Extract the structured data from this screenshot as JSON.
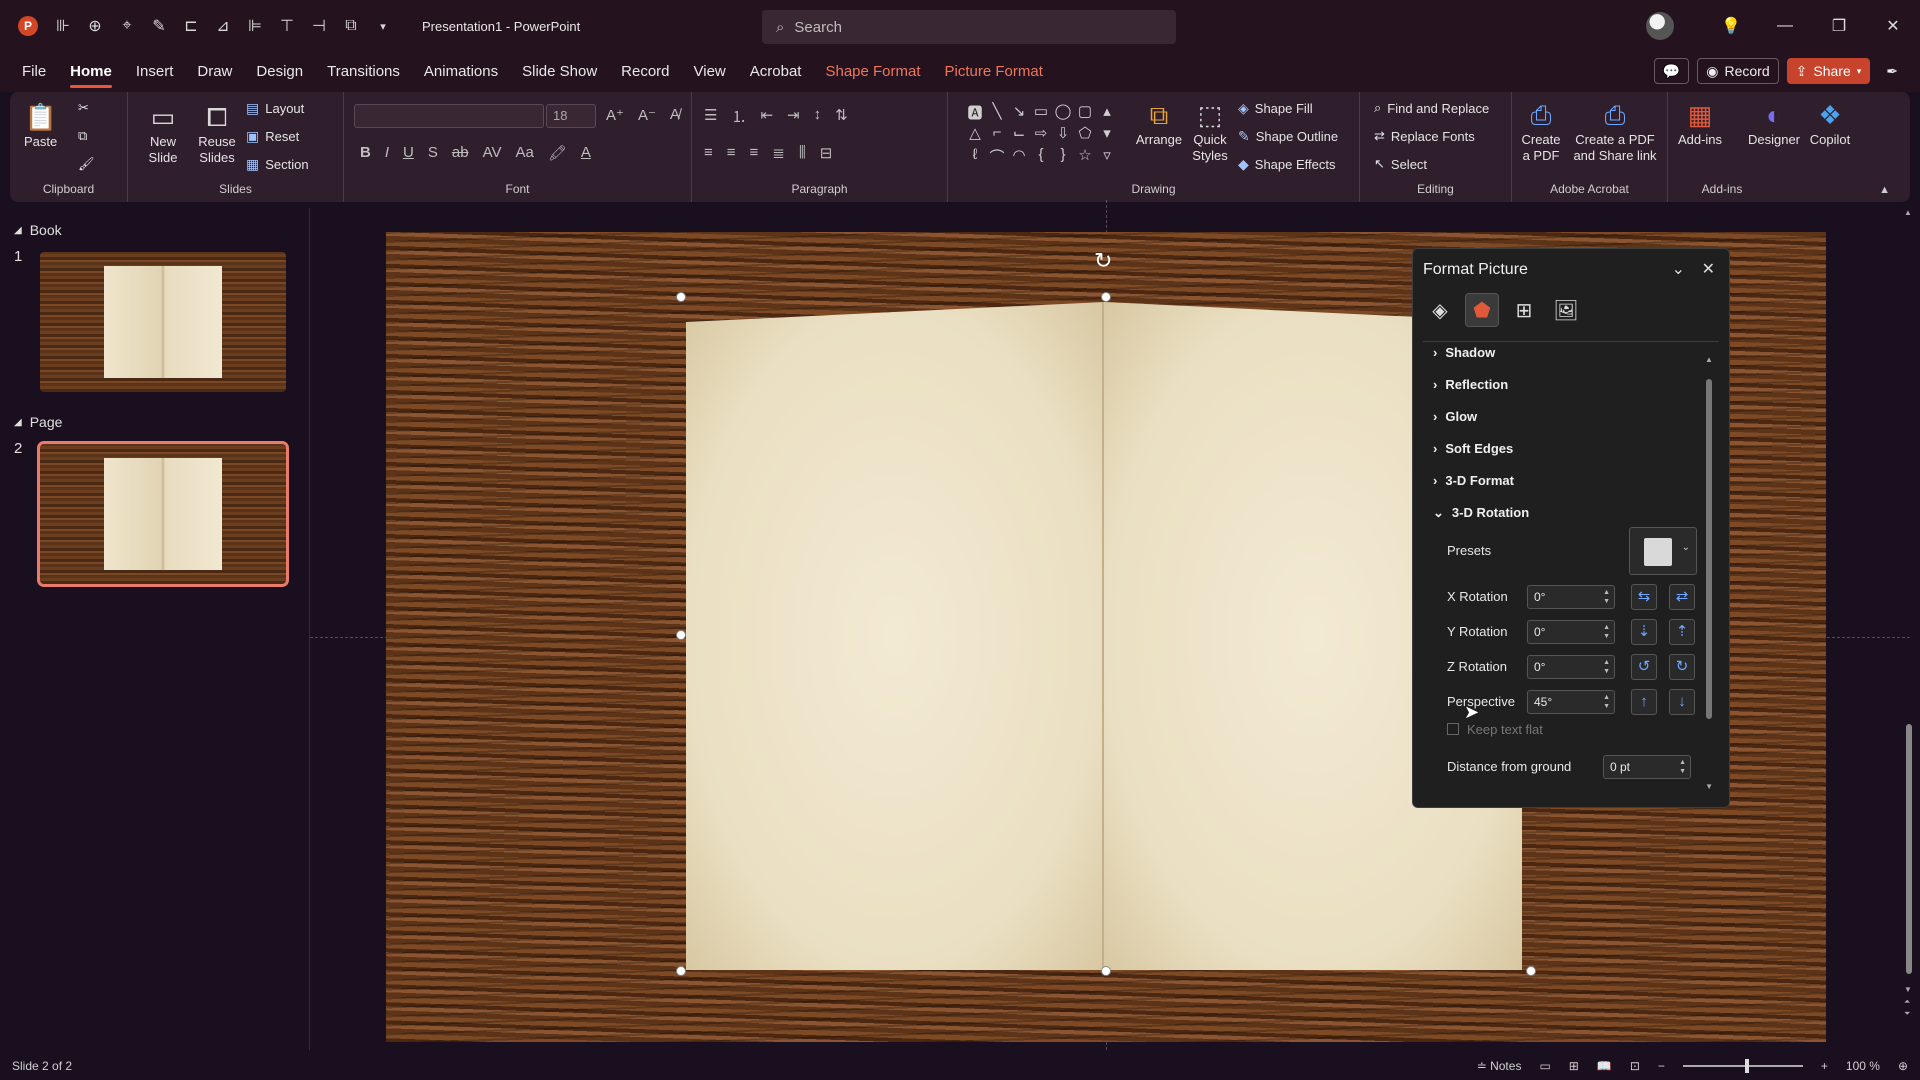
{
  "titlebar": {
    "app_icon": "P",
    "qat_icons": [
      "qat-1-icon",
      "qat-2-icon",
      "qat-3-icon",
      "qat-4-icon",
      "qat-5-icon",
      "qat-6-icon",
      "qat-7-icon",
      "qat-8-icon",
      "qat-9-icon",
      "qat-10-icon"
    ],
    "doc_title": "Presentation1  -  PowerPoint",
    "search_placeholder": "Search"
  },
  "menu": {
    "tabs": [
      "File",
      "Home",
      "Insert",
      "Draw",
      "Design",
      "Transitions",
      "Animations",
      "Slide Show",
      "Record",
      "View",
      "Acrobat",
      "Shape Format",
      "Picture Format"
    ],
    "active_tab": "Home",
    "record_label": "Record",
    "share_label": "Share"
  },
  "ribbon": {
    "clipboard": {
      "paste": "Paste",
      "label": "Clipboard"
    },
    "slides": {
      "new_slide": "New Slide",
      "reuse_slides": "Reuse Slides",
      "layout": "Layout",
      "reset": "Reset",
      "section": "Section",
      "label": "Slides"
    },
    "font": {
      "size": "18",
      "label": "Font"
    },
    "paragraph": {
      "label": "Paragraph"
    },
    "drawing": {
      "arrange": "Arrange",
      "quick_styles": "Quick Styles",
      "shape_fill": "Shape Fill",
      "shape_outline": "Shape Outline",
      "shape_effects": "Shape Effects",
      "label": "Drawing"
    },
    "editing": {
      "find_replace": "Find and Replace",
      "replace_fonts": "Replace Fonts",
      "select": "Select",
      "label": "Editing"
    },
    "acrobat": {
      "create_pdf": "Create a PDF",
      "create_share": "Create a PDF and Share link",
      "label": "Adobe Acrobat"
    },
    "addins": {
      "addins": "Add-ins",
      "designer": "Designer",
      "copilot": "Copilot",
      "label": "Add-ins"
    }
  },
  "slides_panel": {
    "sections": [
      {
        "name": "Book",
        "slide_number": "1"
      },
      {
        "name": "Page",
        "slide_number": "2"
      }
    ]
  },
  "format_pane": {
    "title": "Format Picture",
    "sections": [
      "Shadow",
      "Reflection",
      "Glow",
      "Soft Edges",
      "3-D Format",
      "3-D Rotation"
    ],
    "presets_label": "Presets",
    "x_rotation": {
      "label": "X Rotation",
      "value": "0°"
    },
    "y_rotation": {
      "label": "Y Rotation",
      "value": "0°"
    },
    "z_rotation": {
      "label": "Z Rotation",
      "value": "0°"
    },
    "perspective": {
      "label": "Perspective",
      "value": "45°"
    },
    "keep_text_flat": "Keep text flat",
    "distance": {
      "label": "Distance from ground",
      "value": "0 pt"
    }
  },
  "status": {
    "slide_info": "Slide 2 of 2",
    "notes": "Notes",
    "zoom": "100 %"
  },
  "colors": {
    "accent": "#e8573a",
    "titlebar_bg": "#24121f",
    "ribbon_bg": "#2f1e2b",
    "pane_bg": "#1f1f1f"
  }
}
